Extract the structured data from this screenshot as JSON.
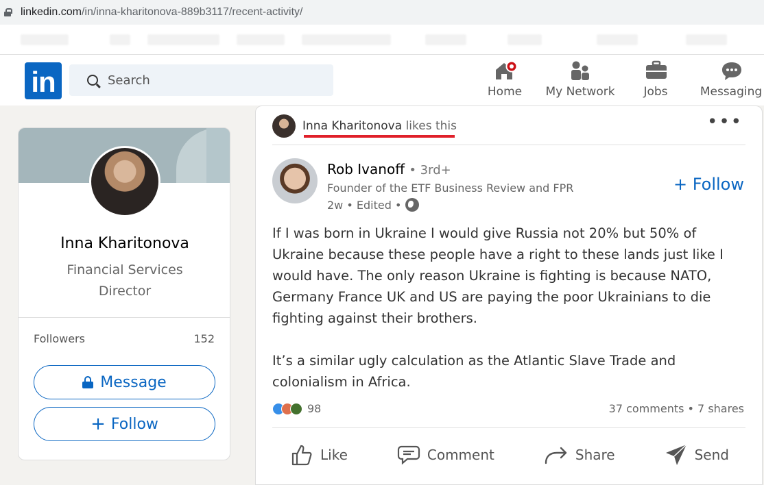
{
  "browser": {
    "url_host": "linkedin.com",
    "url_path": "/in/inna-kharitonova-889b3117/recent-activity/"
  },
  "nav": {
    "logo": "in",
    "search_placeholder": "Search",
    "items": [
      {
        "label": "Home",
        "icon": "home-icon"
      },
      {
        "label": "My Network",
        "icon": "network-icon"
      },
      {
        "label": "Jobs",
        "icon": "briefcase-icon"
      },
      {
        "label": "Messaging",
        "icon": "messaging-icon"
      }
    ],
    "accent": "#0a66c2"
  },
  "profile": {
    "name": "Inna Kharitonova",
    "title": "Financial Services Director",
    "followers_label": "Followers",
    "followers_count": "152",
    "message_label": "Message",
    "follow_label": "Follow"
  },
  "post": {
    "liked_by": "Inna Kharitonova",
    "liked_suffix": "likes this",
    "more": "•••",
    "author": {
      "name": "Rob Ivanoff",
      "degree": "• 3rd+",
      "headline": "Founder of the ETF Business Review and FPR",
      "meta": "2w • Edited •"
    },
    "follow_label": "+ Follow",
    "body": "If I was born in Ukraine I would give Russia not 20% but 50% of Ukraine because these people have a right to these lands just like I would have. The only reason Ukraine is fighting is because NATO, Germany France UK and US are paying the poor Ukrainians to die fighting against their brothers.\n\nIt’s a similar ugly calculation as the Atlantic Slave Trade and colonialism in Africa.",
    "reaction_count": "98",
    "stats": "37 comments • 7 shares",
    "actions": [
      {
        "label": "Like",
        "icon": "like-icon"
      },
      {
        "label": "Comment",
        "icon": "comment-icon"
      },
      {
        "label": "Share",
        "icon": "share-icon"
      },
      {
        "label": "Send",
        "icon": "send-icon"
      }
    ],
    "highlight_color": "#e0202a"
  }
}
